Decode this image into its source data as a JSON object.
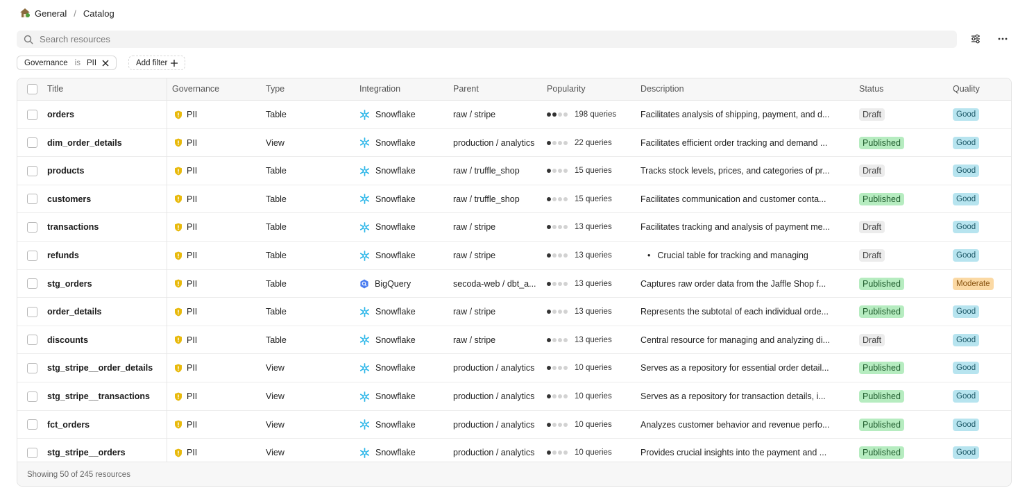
{
  "breadcrumb": {
    "workspace": "General",
    "separator": "/",
    "page": "Catalog"
  },
  "search": {
    "placeholder": "Search resources",
    "value": ""
  },
  "toolbar": {
    "settings_icon": "sliders-icon",
    "more_icon": "more-horizontal-icon"
  },
  "filters": [
    {
      "field": "Governance",
      "operator": "is",
      "value": "PII"
    }
  ],
  "add_filter_label": "Add filter",
  "table": {
    "columns": [
      "Title",
      "Governance",
      "Type",
      "Integration",
      "Parent",
      "Popularity",
      "Description",
      "Status",
      "Quality"
    ],
    "rows": [
      {
        "title": "orders",
        "governance": "PII",
        "type": "Table",
        "integration": "Snowflake",
        "parent": "raw / stripe",
        "popularity_level": 2,
        "popularity": "198 queries",
        "description": "Facilitates analysis of shipping, payment, and d...",
        "status": "Draft",
        "quality": "Good"
      },
      {
        "title": "dim_order_details",
        "governance": "PII",
        "type": "View",
        "integration": "Snowflake",
        "parent": "production / analytics",
        "popularity_level": 1,
        "popularity": "22 queries",
        "description": "Facilitates efficient order tracking and demand ...",
        "status": "Published",
        "quality": "Good"
      },
      {
        "title": "products",
        "governance": "PII",
        "type": "Table",
        "integration": "Snowflake",
        "parent": "raw / truffle_shop",
        "popularity_level": 1,
        "popularity": "15 queries",
        "description": "Tracks stock levels, prices, and categories of pr...",
        "status": "Draft",
        "quality": "Good"
      },
      {
        "title": "customers",
        "governance": "PII",
        "type": "Table",
        "integration": "Snowflake",
        "parent": "raw / truffle_shop",
        "popularity_level": 1,
        "popularity": "15 queries",
        "description": "Facilitates communication and customer conta...",
        "status": "Published",
        "quality": "Good"
      },
      {
        "title": "transactions",
        "governance": "PII",
        "type": "Table",
        "integration": "Snowflake",
        "parent": "raw / stripe",
        "popularity_level": 1,
        "popularity": "13 queries",
        "description": "Facilitates tracking and analysis of payment me...",
        "status": "Draft",
        "quality": "Good"
      },
      {
        "title": "refunds",
        "governance": "PII",
        "type": "Table",
        "integration": "Snowflake",
        "parent": "raw / stripe",
        "popularity_level": 1,
        "popularity": "13 queries",
        "description": "Crucial table for tracking and managing",
        "description_bullet": true,
        "status": "Draft",
        "quality": "Good"
      },
      {
        "title": "stg_orders",
        "governance": "PII",
        "type": "Table",
        "integration": "BigQuery",
        "parent": "secoda-web / dbt_a...",
        "popularity_level": 1,
        "popularity": "13 queries",
        "description": "Captures raw order data from the Jaffle Shop f...",
        "status": "Published",
        "quality": "Moderate"
      },
      {
        "title": "order_details",
        "governance": "PII",
        "type": "Table",
        "integration": "Snowflake",
        "parent": "raw / stripe",
        "popularity_level": 1,
        "popularity": "13 queries",
        "description": "Represents the subtotal of each individual orde...",
        "status": "Published",
        "quality": "Good"
      },
      {
        "title": "discounts",
        "governance": "PII",
        "type": "Table",
        "integration": "Snowflake",
        "parent": "raw / stripe",
        "popularity_level": 1,
        "popularity": "13 queries",
        "description": "Central resource for managing and analyzing di...",
        "status": "Draft",
        "quality": "Good"
      },
      {
        "title": "stg_stripe__order_details",
        "governance": "PII",
        "type": "View",
        "integration": "Snowflake",
        "parent": "production / analytics",
        "popularity_level": 1,
        "popularity": "10 queries",
        "description": "Serves as a repository for essential order detail...",
        "status": "Published",
        "quality": "Good"
      },
      {
        "title": "stg_stripe__transactions",
        "governance": "PII",
        "type": "View",
        "integration": "Snowflake",
        "parent": "production / analytics",
        "popularity_level": 1,
        "popularity": "10 queries",
        "description": "Serves as a repository for transaction details, i...",
        "status": "Published",
        "quality": "Good"
      },
      {
        "title": "fct_orders",
        "governance": "PII",
        "type": "View",
        "integration": "Snowflake",
        "parent": "production / analytics",
        "popularity_level": 1,
        "popularity": "10 queries",
        "description": "Analyzes customer behavior and revenue perfo...",
        "status": "Published",
        "quality": "Good"
      },
      {
        "title": "stg_stripe__orders",
        "governance": "PII",
        "type": "View",
        "integration": "Snowflake",
        "parent": "production / analytics",
        "popularity_level": 1,
        "popularity": "10 queries",
        "description": "Provides crucial insights into the payment and ...",
        "status": "Published",
        "quality": "Good"
      }
    ]
  },
  "footer": {
    "summary": "Showing 50 of 245 resources"
  },
  "colors": {
    "pii": "#e8b90b",
    "snowflake": "#29b5e8",
    "bigquery": "#4a7cf0",
    "published_bg": "#b6ecc0",
    "draft_bg": "#ececec",
    "good_bg": "#b7e4ef",
    "moderate_bg": "#fbd9a4"
  }
}
